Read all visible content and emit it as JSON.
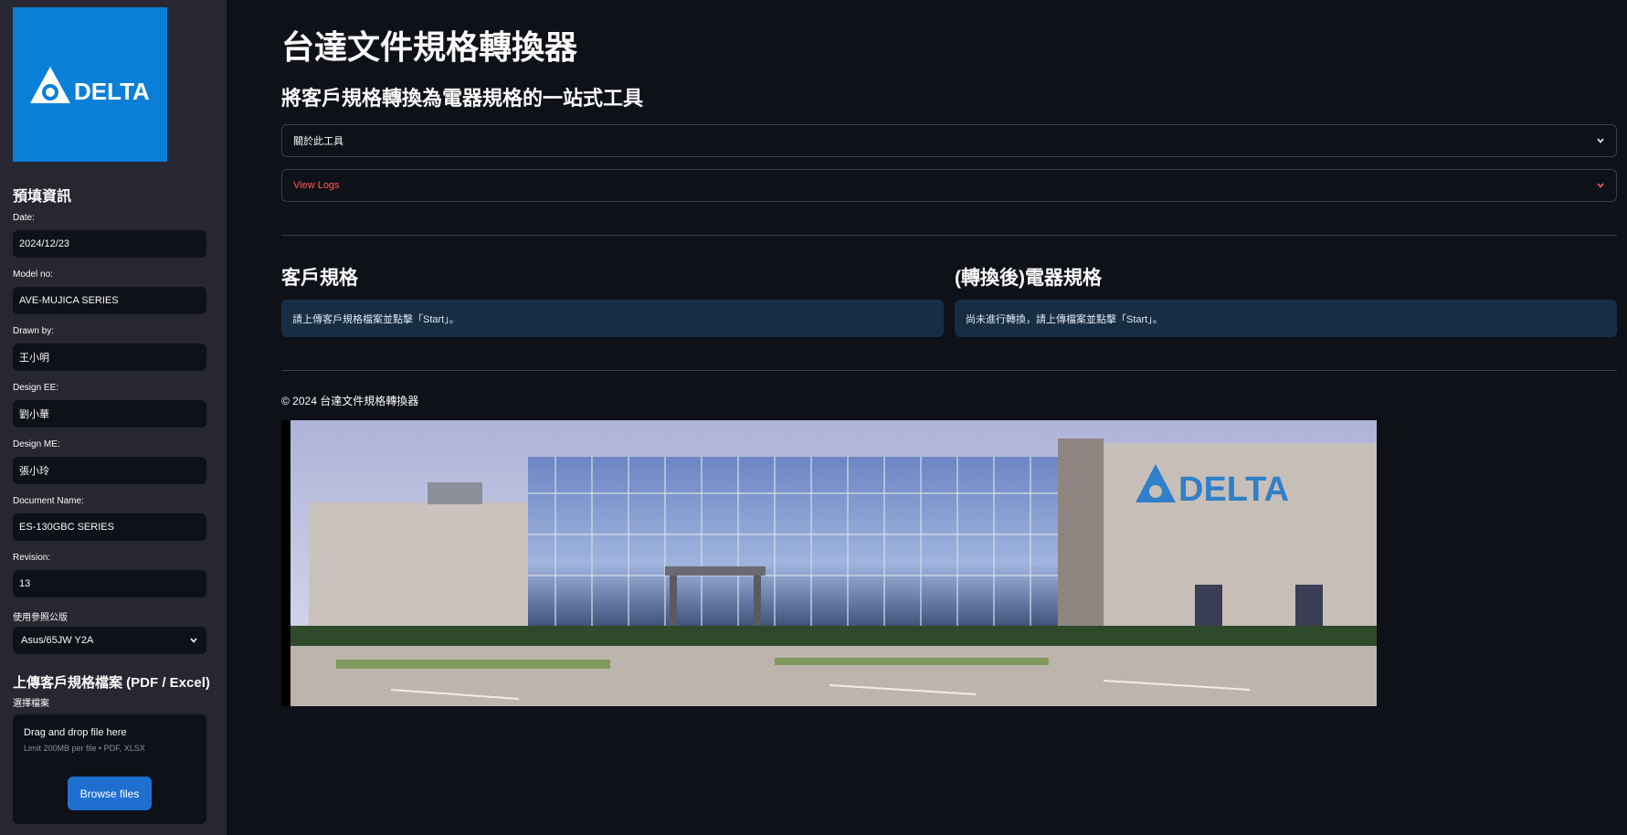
{
  "sidebar": {
    "logo_text": "DELTA",
    "prefill_heading": "預填資訊",
    "fields": [
      {
        "label": "Date:",
        "value": "2024/12/23"
      },
      {
        "label": "Model no:",
        "value": "AVE-MUJICA SERIES"
      },
      {
        "label": "Drawn by:",
        "value": "王小明"
      },
      {
        "label": "Design EE:",
        "value": "劉小華"
      },
      {
        "label": "Design ME:",
        "value": "張小玲"
      },
      {
        "label": "Document Name:",
        "value": "ES-130GBC SERIES"
      },
      {
        "label": "Revision:",
        "value": "13"
      }
    ],
    "reference": {
      "label": "使用參照公版",
      "selected": "Asus/65JW Y2A"
    },
    "upload": {
      "heading": "上傳客戶規格檔案 (PDF / Excel)",
      "sub_label": "選擇檔案",
      "dropzone_title": "Drag and drop file here",
      "dropzone_limit": "Limit 200MB per file • PDF, XLSX",
      "browse_label": "Browse files"
    }
  },
  "main": {
    "title": "台達文件規格轉換器",
    "subtitle": "將客戶規格轉換為電器規格的一站式工具",
    "expanders": {
      "about": "關於此工具",
      "logs": "View Logs"
    },
    "customer_spec": {
      "title": "客戶規格",
      "info": "請上傳客戶規格檔案並點擊「Start」。"
    },
    "converted_spec": {
      "title": "(轉換後)電器規格",
      "info": "尚未進行轉換，請上傳檔案並點擊「Start」。"
    },
    "footer": "© 2024 台達文件規格轉換器",
    "building_sign": "DELTA"
  },
  "colors": {
    "background": "#0e1117",
    "sidebar": "#262730",
    "accent": "#1f6fd1",
    "logo_blue": "#0a7fd8",
    "logs_red": "#ff5a5a",
    "info_bg": "#172d43"
  }
}
